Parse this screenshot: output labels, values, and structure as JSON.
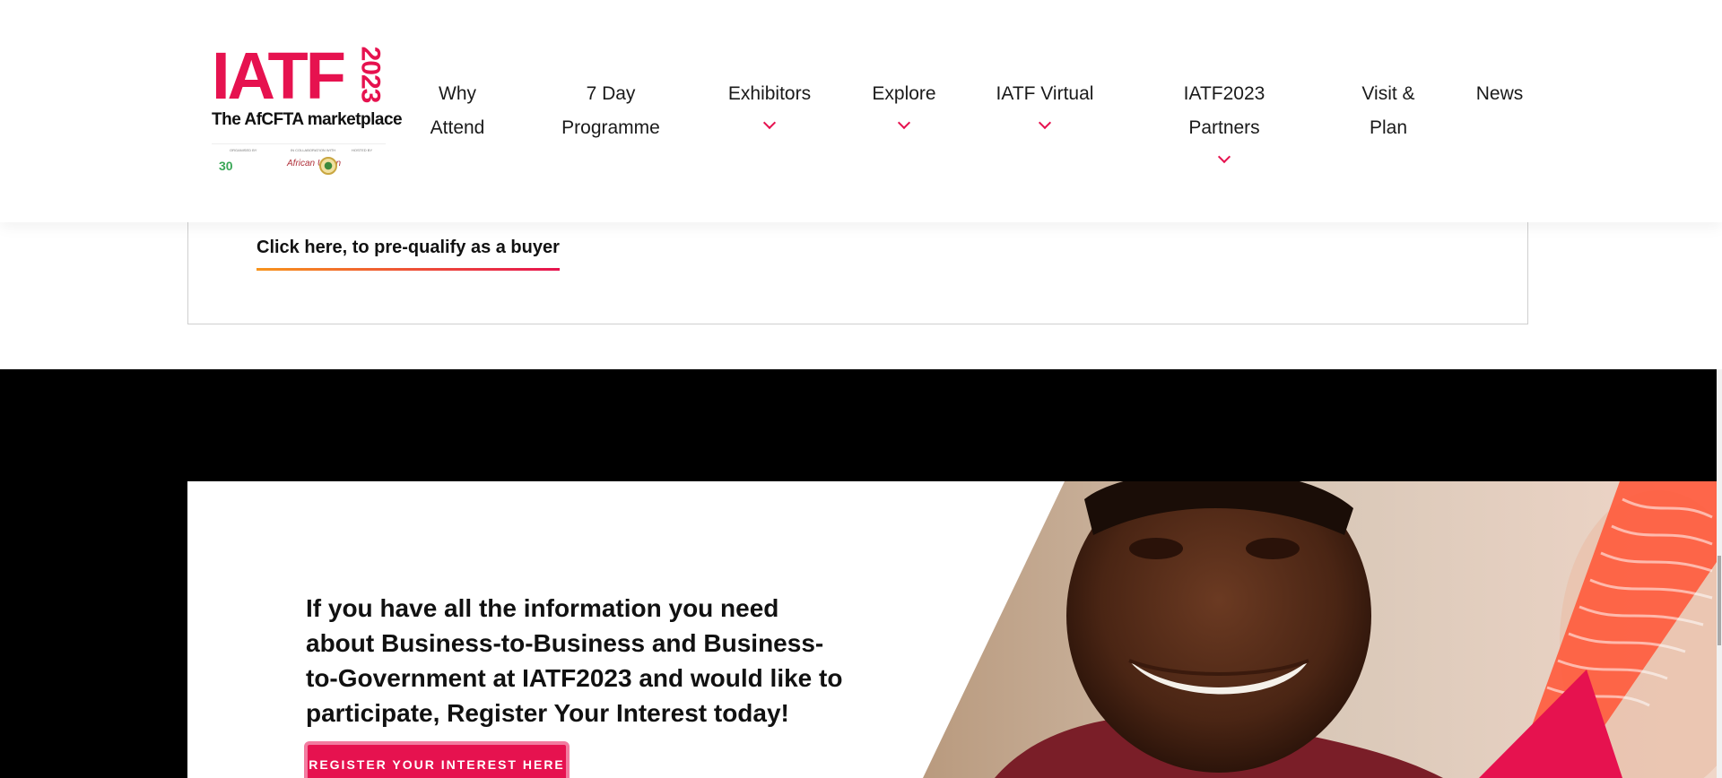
{
  "logo": {
    "main": "IATF",
    "year": "2023",
    "tagline": "The AfCFTA marketplace",
    "partner_labels": [
      "ORGANISED BY",
      "IN COLLABORATION WITH",
      "HOSTED BY"
    ],
    "afrexim_badge": "30",
    "au_mark": "African Union"
  },
  "nav": {
    "items": [
      {
        "label_line1": "Why",
        "label_line2": "Attend",
        "has_dropdown": false
      },
      {
        "label_line1": "7 Day",
        "label_line2": "Programme",
        "has_dropdown": false
      },
      {
        "label_line1": "Exhibitors",
        "label_line2": "",
        "has_dropdown": true
      },
      {
        "label_line1": "Explore",
        "label_line2": "",
        "has_dropdown": true
      },
      {
        "label_line1": "IATF Virtual",
        "label_line2": "",
        "has_dropdown": true
      },
      {
        "label_line1": "IATF2023 Partners",
        "label_line2": "",
        "has_dropdown": true
      },
      {
        "label_line1": "Visit &",
        "label_line2": "Plan",
        "has_dropdown": false
      },
      {
        "label_line1": "News",
        "label_line2": "",
        "has_dropdown": false
      }
    ]
  },
  "buyer": {
    "link_text": "Click here, to pre-qualify as a buyer"
  },
  "promo": {
    "text": "If you have all the information you need about Business-to-Business and Business-to-Government at IATF2023 and would like to participate, Register Your Interest today!",
    "button_label": "REGISTER YOUR INTEREST HERE"
  },
  "colors": {
    "brand_pink": "#e6124f",
    "brand_orange": "#f7941d",
    "band_black": "#000000"
  }
}
